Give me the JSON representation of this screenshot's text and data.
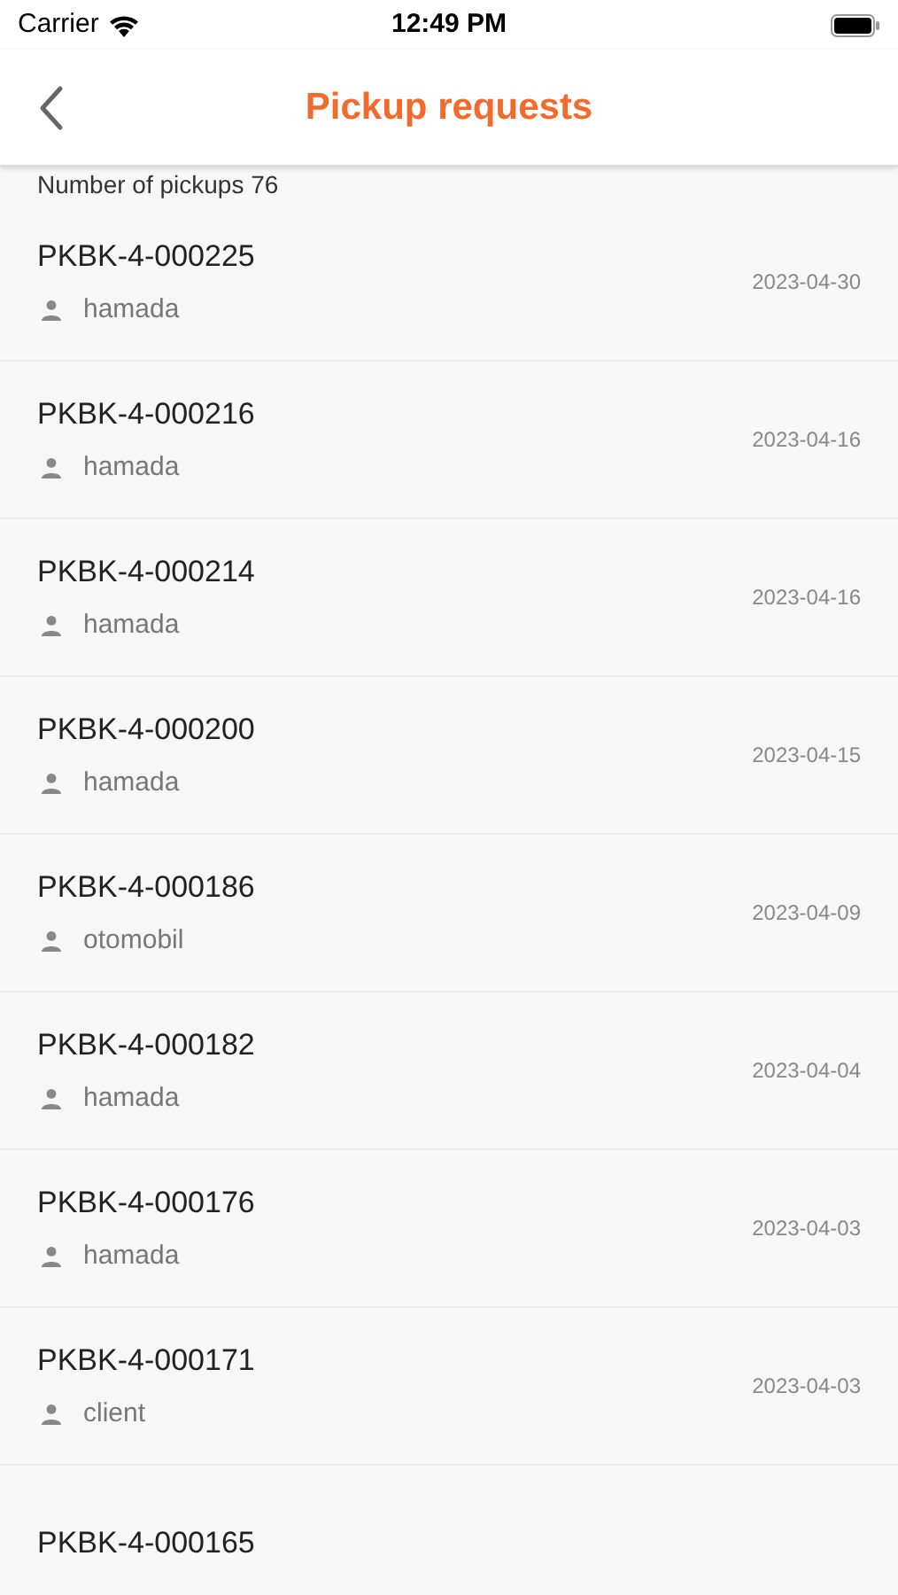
{
  "status_bar": {
    "carrier": "Carrier",
    "time": "12:49 PM"
  },
  "header": {
    "title": "Pickup requests"
  },
  "summary": "Number of pickups 76",
  "pickups": [
    {
      "code": "PKBK-4-000225",
      "user": "hamada",
      "date": "2023-04-30"
    },
    {
      "code": "PKBK-4-000216",
      "user": "hamada",
      "date": "2023-04-16"
    },
    {
      "code": "PKBK-4-000214",
      "user": "hamada",
      "date": "2023-04-16"
    },
    {
      "code": "PKBK-4-000200",
      "user": "hamada",
      "date": "2023-04-15"
    },
    {
      "code": "PKBK-4-000186",
      "user": "otomobil",
      "date": "2023-04-09"
    },
    {
      "code": "PKBK-4-000182",
      "user": "hamada",
      "date": "2023-04-04"
    },
    {
      "code": "PKBK-4-000176",
      "user": "hamada",
      "date": "2023-04-03"
    },
    {
      "code": "PKBK-4-000171",
      "user": "client",
      "date": "2023-04-03"
    },
    {
      "code": "PKBK-4-000165"
    }
  ]
}
